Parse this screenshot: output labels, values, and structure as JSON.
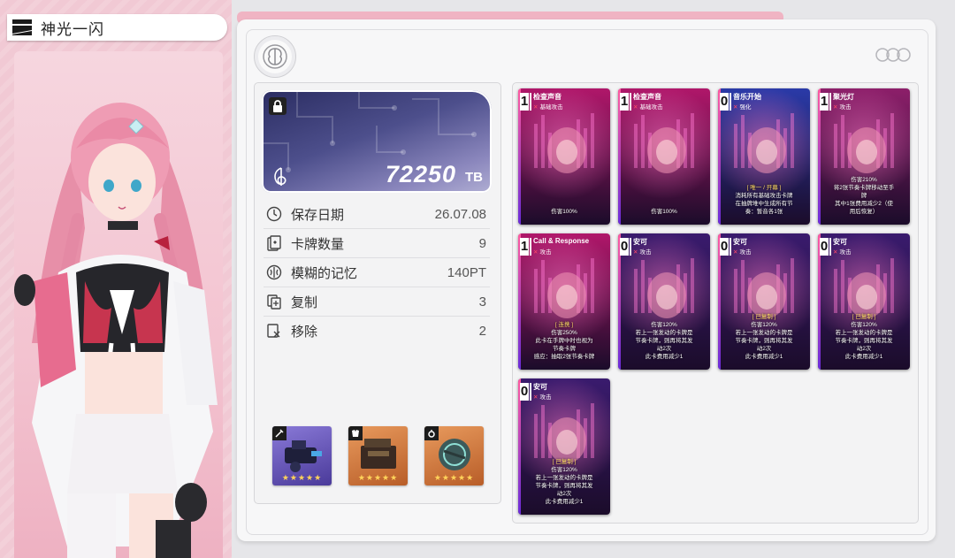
{
  "character": {
    "name": "神光一闪"
  },
  "storage": {
    "value": "72250",
    "unit": "TB"
  },
  "stats": [
    {
      "icon": "clock-icon",
      "label": "保存日期",
      "value": "26.07.08"
    },
    {
      "icon": "card-count-icon",
      "label": "卡牌数量",
      "value": "9"
    },
    {
      "icon": "brain-icon",
      "label": "模糊的记忆",
      "value": "140PT"
    },
    {
      "icon": "copy-icon",
      "label": "复制",
      "value": "3"
    },
    {
      "icon": "remove-icon",
      "label": "移除",
      "value": "2"
    }
  ],
  "equipment": [
    {
      "slot": "weapon",
      "icon": "sword-icon",
      "stars": "★★★★★",
      "color": "#6a55c0"
    },
    {
      "slot": "armor",
      "icon": "armor-icon",
      "stars": "★★★★★",
      "color": "#d9793a"
    },
    {
      "slot": "accessory",
      "icon": "ring-icon",
      "stars": "★★★★★",
      "color": "#d9793a"
    }
  ],
  "cards": [
    {
      "cost": "1",
      "name": "检查声音",
      "type": "基础攻击",
      "desc": [
        "伤害100%"
      ],
      "theme": "#b0176a"
    },
    {
      "cost": "1",
      "name": "检查声音",
      "type": "基础攻击",
      "desc": [
        "伤害100%"
      ],
      "theme": "#b0176a"
    },
    {
      "cost": "0",
      "name": "音乐开始",
      "type": "强化",
      "desc": [
        "[ 唯一 / 开幕 ]",
        "消耗所有基础攻击卡牌",
        "在抽牌堆中生成所有节",
        "奏：暂音各1张"
      ],
      "theme": "#2a3aa8"
    },
    {
      "cost": "1",
      "name": "聚光灯",
      "type": "攻击",
      "desc": [
        "伤害210%",
        "将2张节奏卡牌移动至手",
        "牌",
        "其中1张费用减少2（使",
        "用后恢复）"
      ],
      "theme": "#8d1f6a"
    },
    {
      "cost": "1",
      "name": "Call & Response",
      "type": "攻击",
      "desc": [
        "[ 连携 ]",
        "伤害250%",
        "此卡在手牌中时也视为",
        "节奏卡牌",
        "感应：抽取2张节奏卡牌"
      ],
      "theme": "#b0176a"
    },
    {
      "cost": "0",
      "name": "安可",
      "type": "攻击",
      "desc": [
        "伤害120%",
        "若上一张发动的卡牌是",
        "节奏卡牌，则再将其发",
        "动2次",
        "此卡费用减少1"
      ],
      "theme": "#3a1b6e"
    },
    {
      "cost": "0",
      "name": "安可",
      "type": "攻击",
      "desc": [
        "[ 已复制 ]",
        "伤害120%",
        "若上一张发动的卡牌是",
        "节奏卡牌，则再将其发",
        "动2次",
        "此卡费用减少1"
      ],
      "theme": "#3a1b6e"
    },
    {
      "cost": "0",
      "name": "安可",
      "type": "攻击",
      "desc": [
        "[ 已复制 ]",
        "伤害120%",
        "若上一张发动的卡牌是",
        "节奏卡牌，则再将其发",
        "动2次",
        "此卡费用减少1"
      ],
      "theme": "#3a1b6e"
    },
    {
      "cost": "0",
      "name": "安可",
      "type": "攻击",
      "desc": [
        "[ 已复制 ]",
        "伤害120%",
        "若上一张发动的卡牌是",
        "节奏卡牌，则再将其发",
        "动2次",
        "此卡费用减少1"
      ],
      "theme": "#3a1b6e"
    }
  ],
  "colors": {
    "accent_pink": "#f0b4c3",
    "panel_bg": "#f7f7f8",
    "card_cost_x": "#ff4a6a"
  }
}
